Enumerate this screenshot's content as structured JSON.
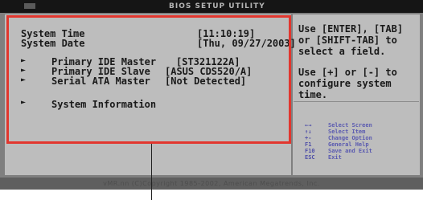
{
  "bios": {
    "header_title": "BIOS SETUP UTILITY",
    "fields": [
      {
        "label": "System Time",
        "value": "[11:10:19]"
      },
      {
        "label": "System Date",
        "value": "[Thu, 09/27/2003]"
      }
    ],
    "menu_items": [
      {
        "label": "Primary IDE Master",
        "value": "[ST321122A]"
      },
      {
        "label": "Primary IDE Slave",
        "value": "[ASUS CDS520/A]"
      },
      {
        "label": "Serial ATA Master",
        "value": "[Not Detected]"
      },
      {
        "label": "System Information",
        "value": ""
      }
    ],
    "help_text": {
      "line1": "Use [ENTER], [TAB]",
      "line2": "or [SHIFT-TAB] to",
      "line3": "select a field.",
      "line4": "Use [+] or [-] to",
      "line5": "configure system",
      "line6": "time."
    },
    "keys": [
      {
        "key": "←→",
        "desc": "Select Screen"
      },
      {
        "key": "↑↓",
        "desc": "Select Item"
      },
      {
        "key": "+-",
        "desc": "Change Option"
      },
      {
        "key": "F1",
        "desc": "General Help"
      },
      {
        "key": "F10",
        "desc": "Save and Exit"
      },
      {
        "key": "ESC",
        "desc": "Exit"
      }
    ],
    "copyright": "vMR.nn (C)Copyright 1985-2002, American Megatrends, Inc."
  }
}
